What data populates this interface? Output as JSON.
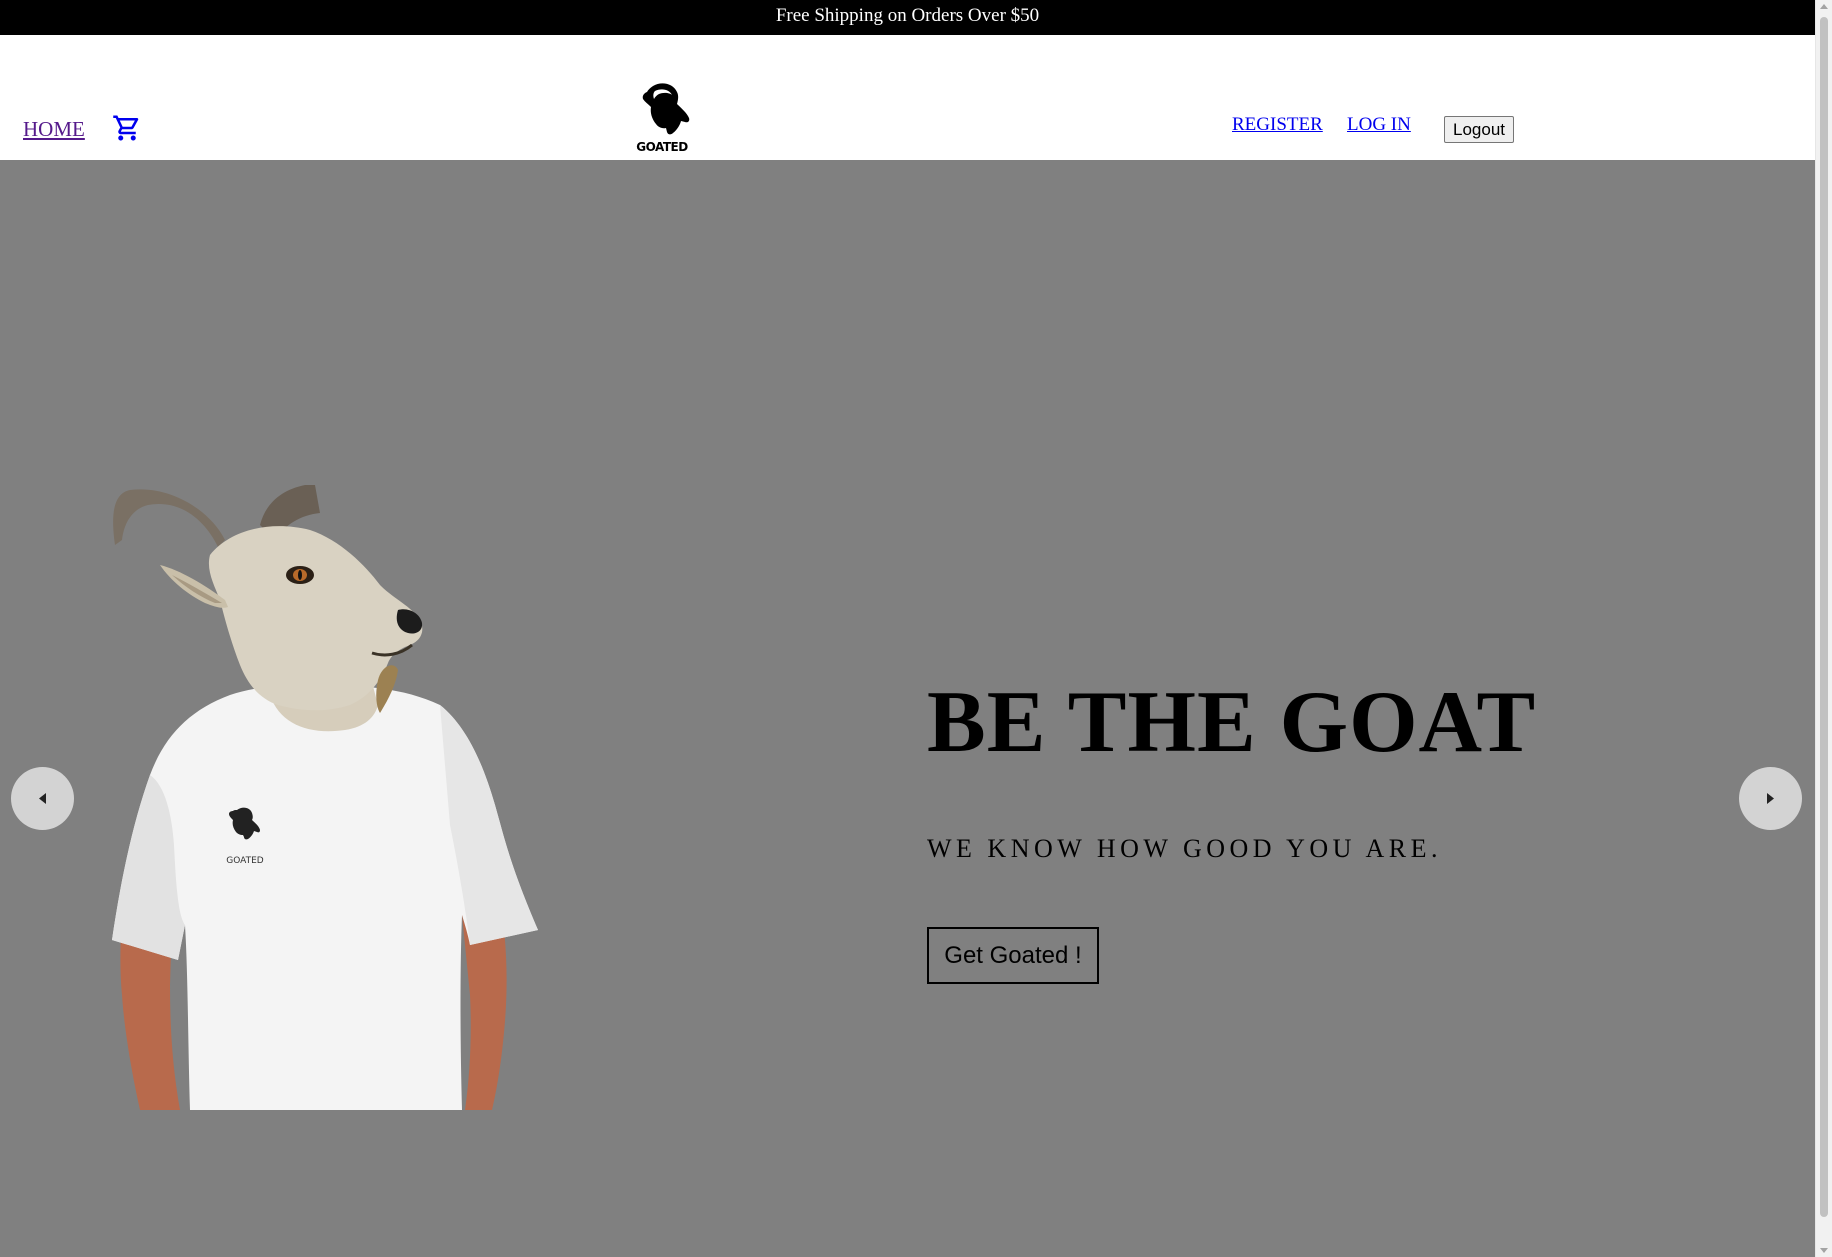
{
  "announcement": {
    "text": "Free Shipping on Orders Over $50"
  },
  "header": {
    "home_label": "HOME",
    "cart_icon": "shopping-cart-icon",
    "logo_text": "GOATED",
    "register_label": "REGISTER",
    "login_label": "LOG IN",
    "logout_label": "Logout"
  },
  "hero": {
    "title": "BE THE GOAT",
    "subtitle": "WE KNOW HOW GOOD YOU ARE.",
    "cta_label": "Get Goated !",
    "shirt_logo_text": "GOATED",
    "prev_icon": "chevron-left-icon",
    "next_icon": "chevron-right-icon"
  },
  "colors": {
    "announcement_bg": "#000000",
    "hero_bg": "#808080",
    "link_visited": "#551a8b",
    "link": "#0000ee",
    "carousel_arrow_bg": "#d3d3d3"
  }
}
